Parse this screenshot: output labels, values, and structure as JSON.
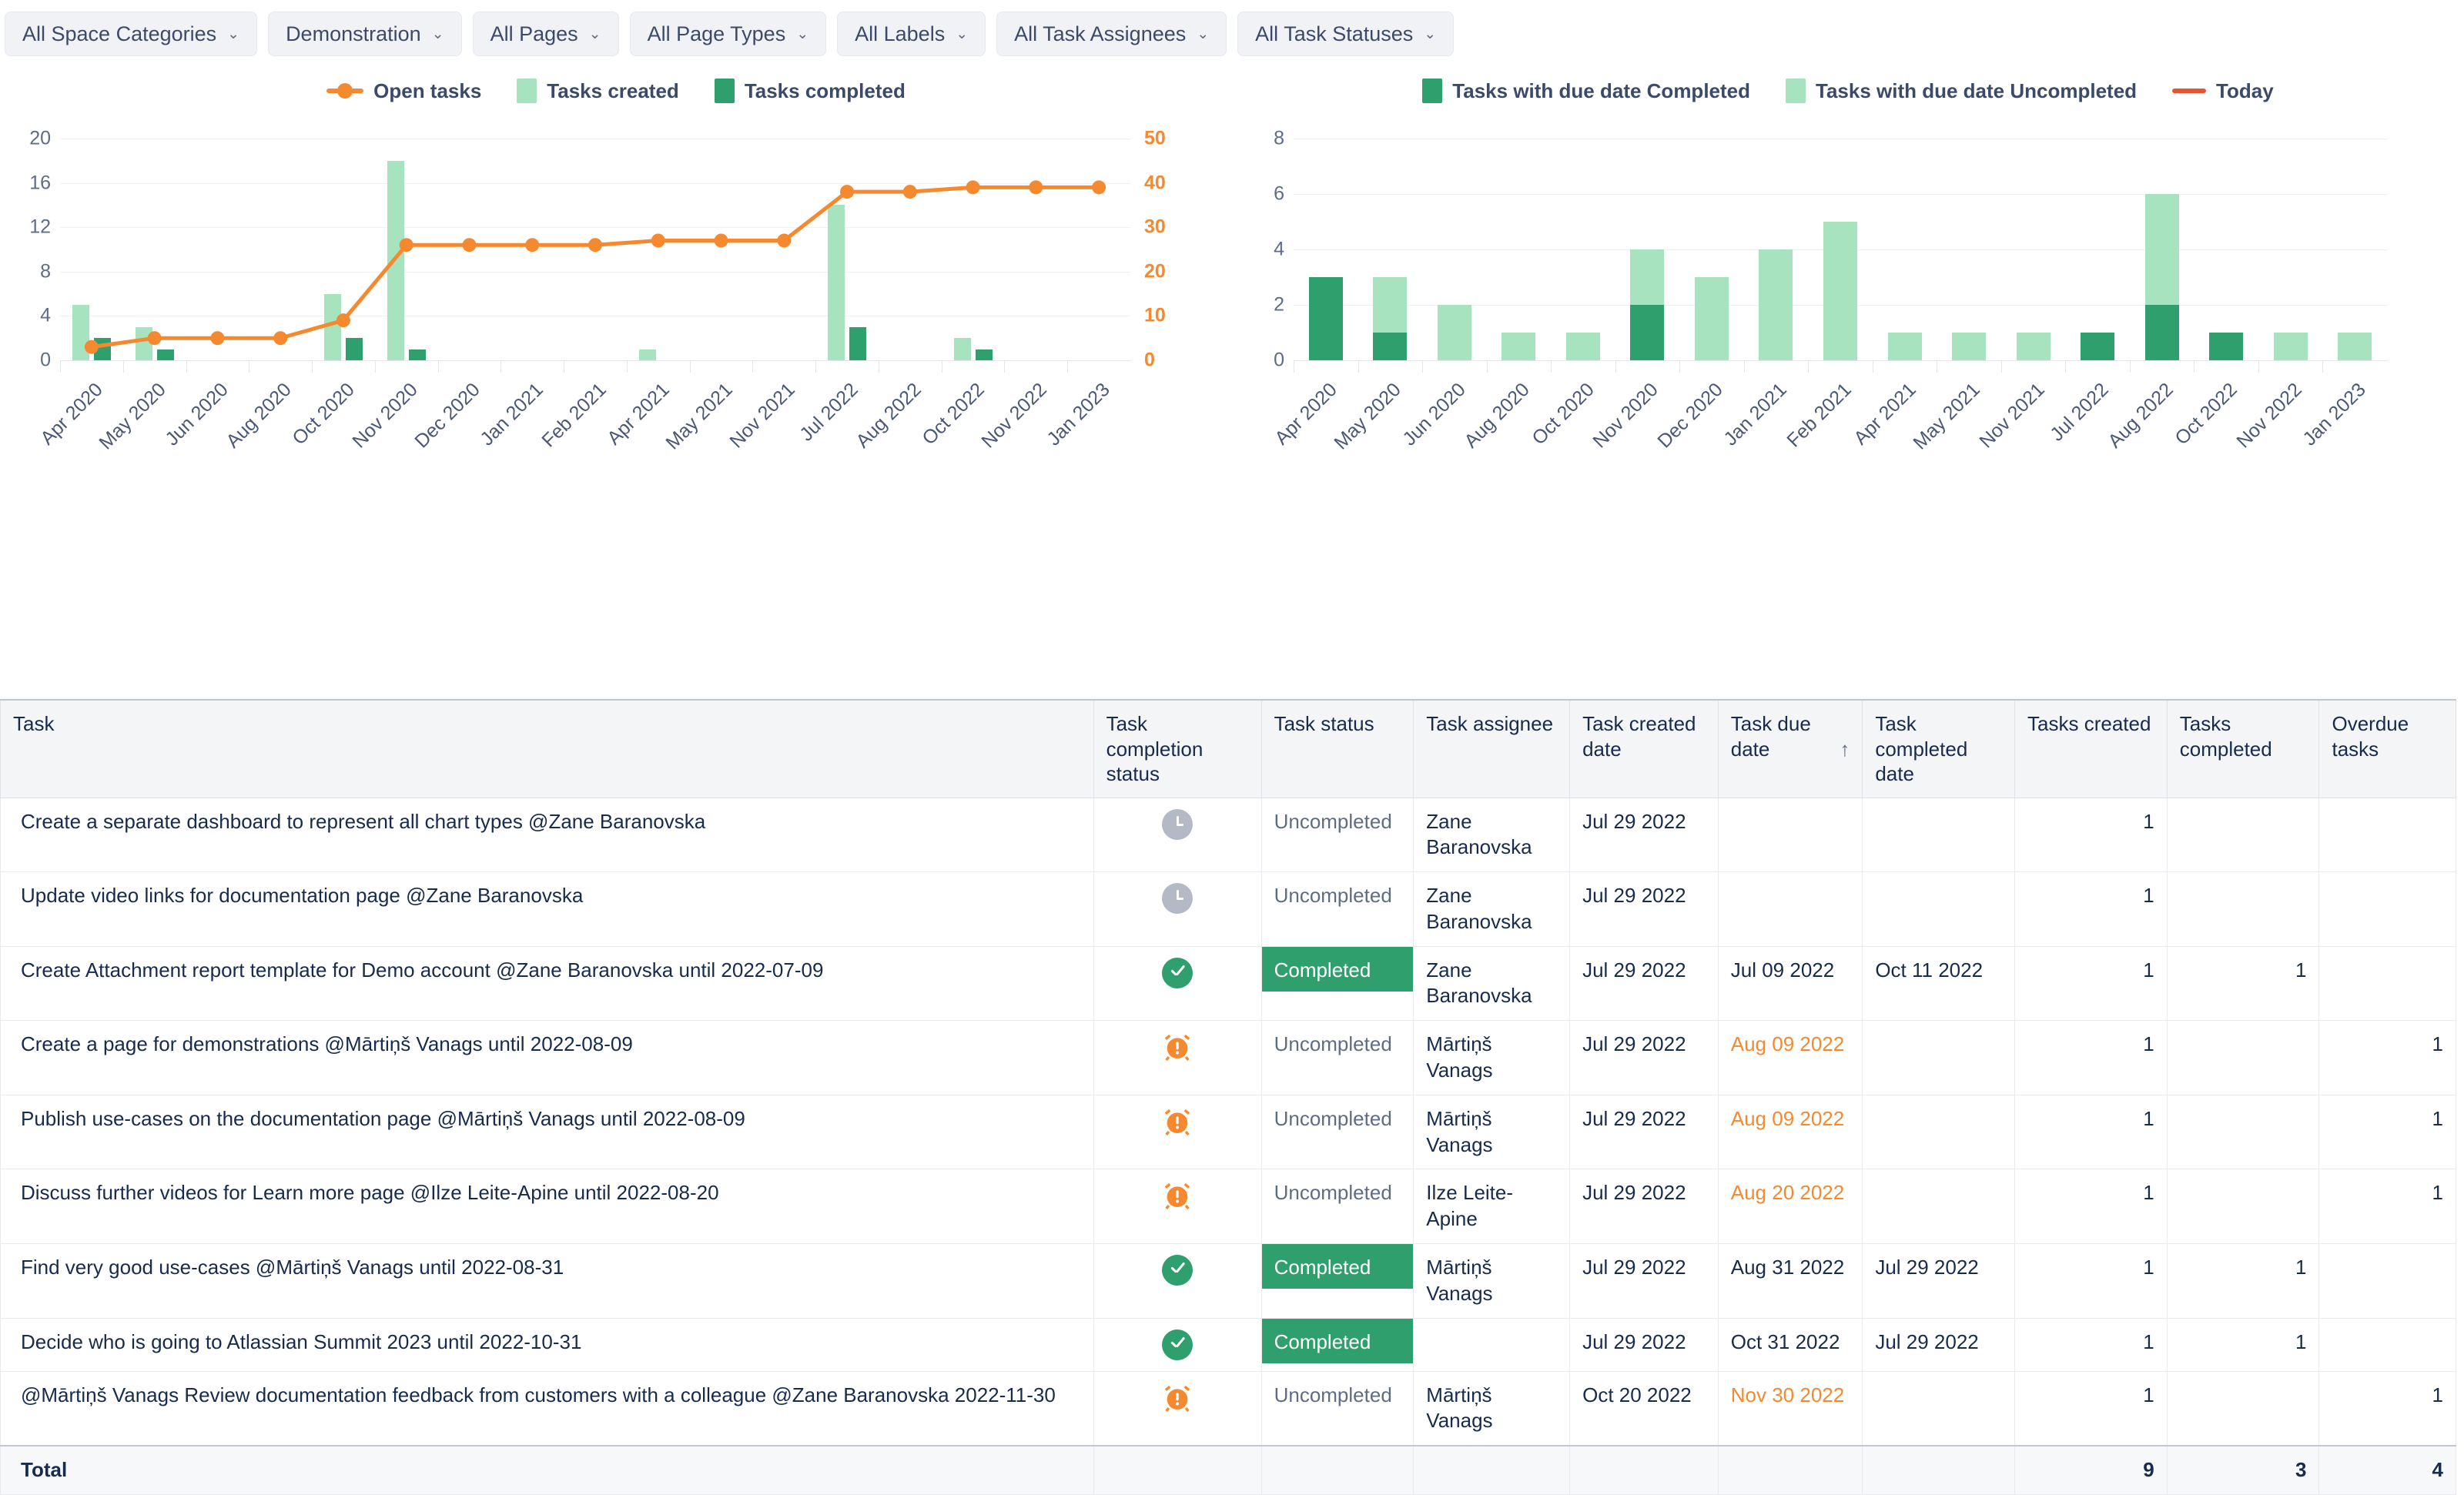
{
  "filters": [
    {
      "label": "All Space Categories",
      "icon": "chevron-down-icon"
    },
    {
      "label": "Demonstration",
      "icon": "chevron-down-icon"
    },
    {
      "label": "All Pages",
      "icon": "chevron-down-icon"
    },
    {
      "label": "All Page Types",
      "icon": "chevron-down-icon"
    },
    {
      "label": "All Labels",
      "icon": "chevron-down-icon"
    },
    {
      "label": "All Task Assignees",
      "icon": "chevron-down-icon"
    },
    {
      "label": "All Task Statuses",
      "icon": "chevron-down-icon"
    }
  ],
  "colors": {
    "created_green": "#A7E3BF",
    "completed_green": "#2FA06D",
    "orange": "#F5892F",
    "text_dark": "#172B4D",
    "text_muted": "#5E6C84"
  },
  "chart_data": [
    {
      "id": "tasks-over-time",
      "type": "bar",
      "title": "",
      "categories": [
        "Apr 2020",
        "May 2020",
        "Jun 2020",
        "Aug 2020",
        "Oct 2020",
        "Nov 2020",
        "Dec 2020",
        "Jan 2021",
        "Feb 2021",
        "Apr 2021",
        "May 2021",
        "Nov 2021",
        "Jul 2022",
        "Aug 2022",
        "Oct 2022",
        "Nov 2022",
        "Jan 2023"
      ],
      "legend": [
        {
          "name": "Open tasks",
          "marker": "line-marker",
          "color": "#F5892F"
        },
        {
          "name": "Tasks created",
          "marker": "square",
          "color": "#A7E3BF"
        },
        {
          "name": "Tasks completed",
          "marker": "square",
          "color": "#2FA06D"
        }
      ],
      "legend_position": "top-center",
      "series": [
        {
          "name": "Tasks created",
          "axis": "left",
          "values": [
            5,
            3,
            0,
            0,
            6,
            18,
            0,
            0,
            0,
            1,
            0,
            0,
            14,
            0,
            2,
            0,
            0
          ]
        },
        {
          "name": "Tasks completed",
          "axis": "left",
          "values": [
            2,
            1,
            0,
            0,
            2,
            1,
            0,
            0,
            0,
            0,
            0,
            0,
            3,
            0,
            1,
            0,
            0
          ]
        },
        {
          "name": "Open tasks",
          "axis": "right",
          "values": [
            3,
            5,
            5,
            5,
            9,
            26,
            26,
            26,
            26,
            27,
            27,
            27,
            38,
            38,
            39,
            39,
            39
          ]
        }
      ],
      "yaxis_left": {
        "ticks": [
          0,
          4,
          8,
          12,
          16,
          20
        ],
        "ylim": [
          0,
          20
        ]
      },
      "yaxis_right": {
        "ticks": [
          0,
          10,
          20,
          30,
          40,
          50
        ],
        "ylim": [
          0,
          50
        ],
        "color": "#F5892F"
      },
      "grid": true
    },
    {
      "id": "tasks-with-due-date",
      "type": "bar",
      "title": "",
      "stacked": true,
      "categories": [
        "Apr 2020",
        "May 2020",
        "Jun 2020",
        "Aug 2020",
        "Oct 2020",
        "Nov 2020",
        "Dec 2020",
        "Jan 2021",
        "Feb 2021",
        "Apr 2021",
        "May 2021",
        "Nov 2021",
        "Jul 2022",
        "Aug 2022",
        "Oct 2022",
        "Nov 2022",
        "Jan 2023"
      ],
      "legend": [
        {
          "name": "Tasks with due date Completed",
          "marker": "square",
          "color": "#2FA06D"
        },
        {
          "name": "Tasks with due date Uncompleted",
          "marker": "square",
          "color": "#A7E3BF"
        },
        {
          "name": "Today",
          "marker": "line",
          "color": "#E8542F"
        }
      ],
      "legend_position": "top-center",
      "series": [
        {
          "name": "Tasks with due date Completed",
          "values": [
            3,
            1,
            0,
            0,
            0,
            2,
            0,
            0,
            0,
            0,
            0,
            0,
            1,
            2,
            1,
            0,
            0
          ]
        },
        {
          "name": "Tasks with due date Uncompleted",
          "values": [
            0,
            2,
            2,
            1,
            1,
            2,
            3,
            4,
            5,
            1,
            1,
            1,
            0,
            4,
            0,
            1,
            1
          ]
        }
      ],
      "yaxis": {
        "ticks": [
          0,
          2,
          4,
          6,
          8
        ],
        "ylim": [
          0,
          8
        ]
      },
      "grid": true
    }
  ],
  "table": {
    "columns": [
      {
        "key": "task",
        "label": "Task"
      },
      {
        "key": "completion_status",
        "label": "Task completion status"
      },
      {
        "key": "status",
        "label": "Task status"
      },
      {
        "key": "assignee",
        "label": "Task assignee"
      },
      {
        "key": "created",
        "label": "Task created date"
      },
      {
        "key": "due",
        "label": "Task due date",
        "sort": "↑"
      },
      {
        "key": "completed_date",
        "label": "Task completed date"
      },
      {
        "key": "tasks_created",
        "label": "Tasks created"
      },
      {
        "key": "tasks_completed",
        "label": "Tasks completed"
      },
      {
        "key": "overdue",
        "label": "Overdue tasks"
      }
    ],
    "rows": [
      {
        "task": "Create a separate dashboard to represent all chart types @Zane Baranovska",
        "icon": "clock-icon",
        "status": "Uncompleted",
        "status_style": "muted",
        "assignee": "Zane Baranovska",
        "created": "Jul 29 2022",
        "due": "",
        "due_overdue": false,
        "completed_date": "",
        "tasks_created": "1",
        "tasks_completed": "",
        "overdue": ""
      },
      {
        "task": "Update video links for documentation page @Zane Baranovska",
        "icon": "clock-icon",
        "status": "Uncompleted",
        "status_style": "muted",
        "assignee": "Zane Baranovska",
        "created": "Jul 29 2022",
        "due": "",
        "due_overdue": false,
        "completed_date": "",
        "tasks_created": "1",
        "tasks_completed": "",
        "overdue": ""
      },
      {
        "task": "Create Attachment report template for Demo account @Zane Baranovska  until 2022-07-09",
        "icon": "check-icon",
        "status": "Completed",
        "status_style": "pill",
        "assignee": "Zane Baranovska",
        "created": "Jul 29 2022",
        "due": "Jul 09 2022",
        "due_overdue": false,
        "completed_date": "Oct 11 2022",
        "tasks_created": "1",
        "tasks_completed": "1",
        "overdue": ""
      },
      {
        "task": "Create a page for demonstrations @Mārtiņš Vanags  until 2022-08-09",
        "icon": "alarm-icon",
        "status": "Uncompleted",
        "status_style": "muted",
        "assignee": "Mārtiņš Vanags",
        "created": "Jul 29 2022",
        "due": "Aug 09 2022",
        "due_overdue": true,
        "completed_date": "",
        "tasks_created": "1",
        "tasks_completed": "",
        "overdue": "1"
      },
      {
        "task": "Publish use-cases on the documentation page @Mārtiņš Vanags  until 2022-08-09",
        "icon": "alarm-icon",
        "status": "Uncompleted",
        "status_style": "muted",
        "assignee": "Mārtiņš Vanags",
        "created": "Jul 29 2022",
        "due": "Aug 09 2022",
        "due_overdue": true,
        "completed_date": "",
        "tasks_created": "1",
        "tasks_completed": "",
        "overdue": "1"
      },
      {
        "task": "Discuss further videos for Learn more page @Ilze Leite-Apine  until 2022-08-20",
        "icon": "alarm-icon",
        "status": "Uncompleted",
        "status_style": "muted",
        "assignee": "Ilze Leite-Apine",
        "created": "Jul 29 2022",
        "due": "Aug 20 2022",
        "due_overdue": true,
        "completed_date": "",
        "tasks_created": "1",
        "tasks_completed": "",
        "overdue": "1"
      },
      {
        "task": "Find very good use-cases @Mārtiņš Vanags  until 2022-08-31",
        "icon": "check-icon",
        "status": "Completed",
        "status_style": "pill",
        "assignee": "Mārtiņš Vanags",
        "created": "Jul 29 2022",
        "due": "Aug 31 2022",
        "due_overdue": false,
        "completed_date": "Jul 29 2022",
        "tasks_created": "1",
        "tasks_completed": "1",
        "overdue": ""
      },
      {
        "task": "Decide who is going to Atlassian Summit 2023 until  2022-10-31",
        "icon": "check-icon",
        "status": "Completed",
        "status_style": "pill",
        "assignee": "",
        "created": "Jul 29 2022",
        "due": "Oct 31 2022",
        "due_overdue": false,
        "completed_date": "Jul 29 2022",
        "tasks_created": "1",
        "tasks_completed": "1",
        "overdue": ""
      },
      {
        "task": "@Mārtiņš Vanags Review documentation feedback from customers with a colleague @Zane Baranovska 2022-11-30",
        "icon": "alarm-icon",
        "status": "Uncompleted",
        "status_style": "muted",
        "assignee": "Mārtiņš Vanags",
        "created": "Oct 20 2022",
        "due": "Nov 30 2022",
        "due_overdue": true,
        "completed_date": "",
        "tasks_created": "1",
        "tasks_completed": "",
        "overdue": "1"
      }
    ],
    "total": {
      "label": "Total",
      "tasks_created": "9",
      "tasks_completed": "3",
      "overdue": "4"
    }
  }
}
